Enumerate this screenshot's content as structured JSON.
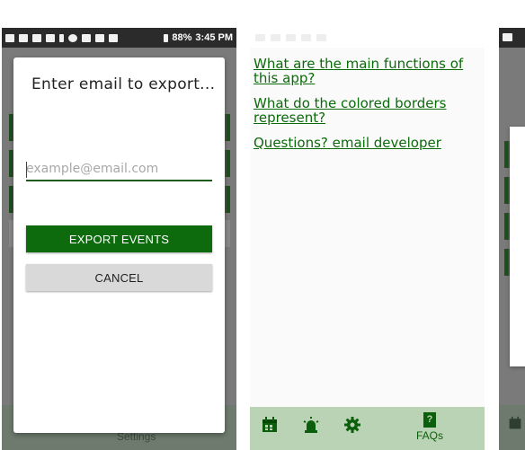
{
  "screen1": {
    "status_bar": {
      "battery": "88%",
      "time": "3:45 PM"
    },
    "dialog": {
      "title": "Enter email to export...",
      "email_input": {
        "value": "",
        "placeholder": "example@email.com"
      },
      "export_button_label": "EXPORT EVENTS",
      "cancel_button_label": "CANCEL"
    },
    "background_tab_label": "Settings"
  },
  "screen2": {
    "faq_links": [
      "What are the main functions of this app?",
      "What do the colored borders represent?",
      "Questions? email developer"
    ],
    "bottom_nav": {
      "icons": [
        "calendar-icon",
        "siren-icon",
        "gear-icon",
        "book-icon"
      ],
      "faqs_book_glyph": "?",
      "faqs_label": "FAQs"
    }
  },
  "colors": {
    "accent_green": "#0d6b0d",
    "link_green": "#0b6b0b",
    "bottom_nav_bg": "#bad3b4",
    "cancel_bg": "#d9d9d9"
  }
}
